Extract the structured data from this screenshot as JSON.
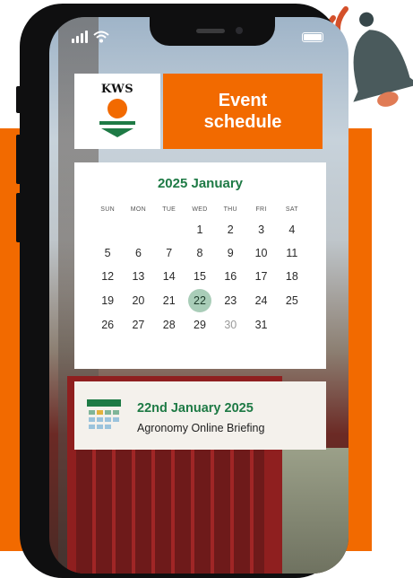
{
  "brand": {
    "logo_text": "KWS",
    "accent_orange": "#f26a00",
    "accent_green": "#1e7a45"
  },
  "header": {
    "title_line1": "Event",
    "title_line2": "schedule"
  },
  "calendar": {
    "title": "2025 January",
    "weekdays": [
      "SUN",
      "MON",
      "TUE",
      "WED",
      "THU",
      "FRI",
      "SAT"
    ],
    "weeks": [
      [
        "",
        "",
        "",
        "1",
        "2",
        "3",
        "4"
      ],
      [
        "5",
        "6",
        "7",
        "8",
        "9",
        "10",
        "11"
      ],
      [
        "12",
        "13",
        "14",
        "15",
        "16",
        "17",
        "18"
      ],
      [
        "19",
        "20",
        "21",
        "22",
        "23",
        "24",
        "25"
      ],
      [
        "26",
        "27",
        "28",
        "29",
        "30",
        "31",
        ""
      ]
    ],
    "selected_day": "22",
    "muted_days": [
      "30"
    ]
  },
  "event": {
    "date": "22nd January 2025",
    "name": "Agronomy Online Briefing",
    "icon": "calendar-icon"
  },
  "decor": {
    "bell_icon": "bell-icon"
  }
}
